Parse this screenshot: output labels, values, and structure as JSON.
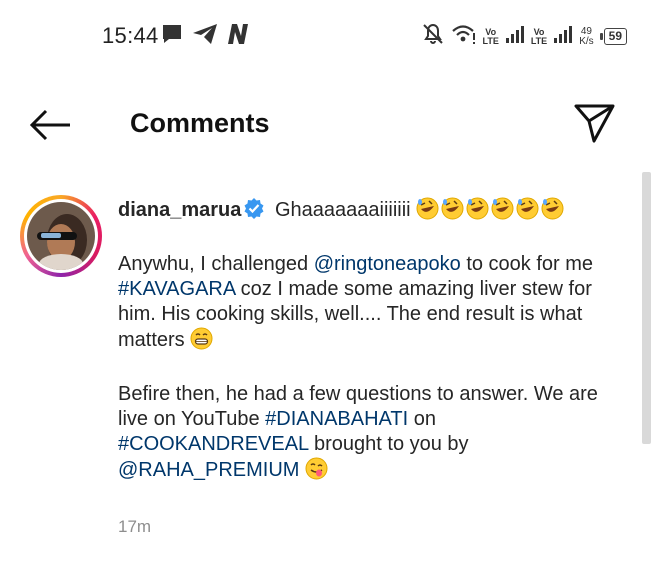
{
  "status_bar": {
    "time": "15:44",
    "left_icons": [
      "chat-bubble-icon",
      "telegram-icon",
      "n-logo-icon"
    ],
    "right_icons": [
      "bell-muted-icon",
      "wifi-icon",
      "signal-icon",
      "signal-icon"
    ],
    "network1": "Vo",
    "network1_sub": "LTE",
    "network2": "Vo",
    "network2_sub": "LTE",
    "speed_value": "49",
    "speed_unit": "K/s",
    "battery": "59"
  },
  "header": {
    "title": "Comments",
    "back_icon": "arrow-left-icon",
    "share_icon": "paper-plane-icon"
  },
  "comment": {
    "username": "diana_marua",
    "first_text": "Ghaaaaaaaiiiiiii",
    "para1_a": "Anywhu, I challenged ",
    "para1_mention": "@ringtoneapoko",
    "para1_b": " to cook for me ",
    "para1_tag": "#KAVAGARA",
    "para1_c": " coz I made some amazing liver stew for him. His cooking skills, well.... The end result is what matters",
    "para2_a": "Befire then, he had a few questions to answer. We are live on YouTube ",
    "para2_tag1": "#DIANABAHATI",
    "para2_b": " on ",
    "para2_tag2": "#COOKANDREVEAL",
    "para2_c": " brought to you by ",
    "para2_mention": "@RAHA_PREMIUM",
    "time_ago": "17m"
  },
  "colors": {
    "link": "#00376b",
    "verified": "#3897f0",
    "muted_text": "#8e8e8e"
  }
}
